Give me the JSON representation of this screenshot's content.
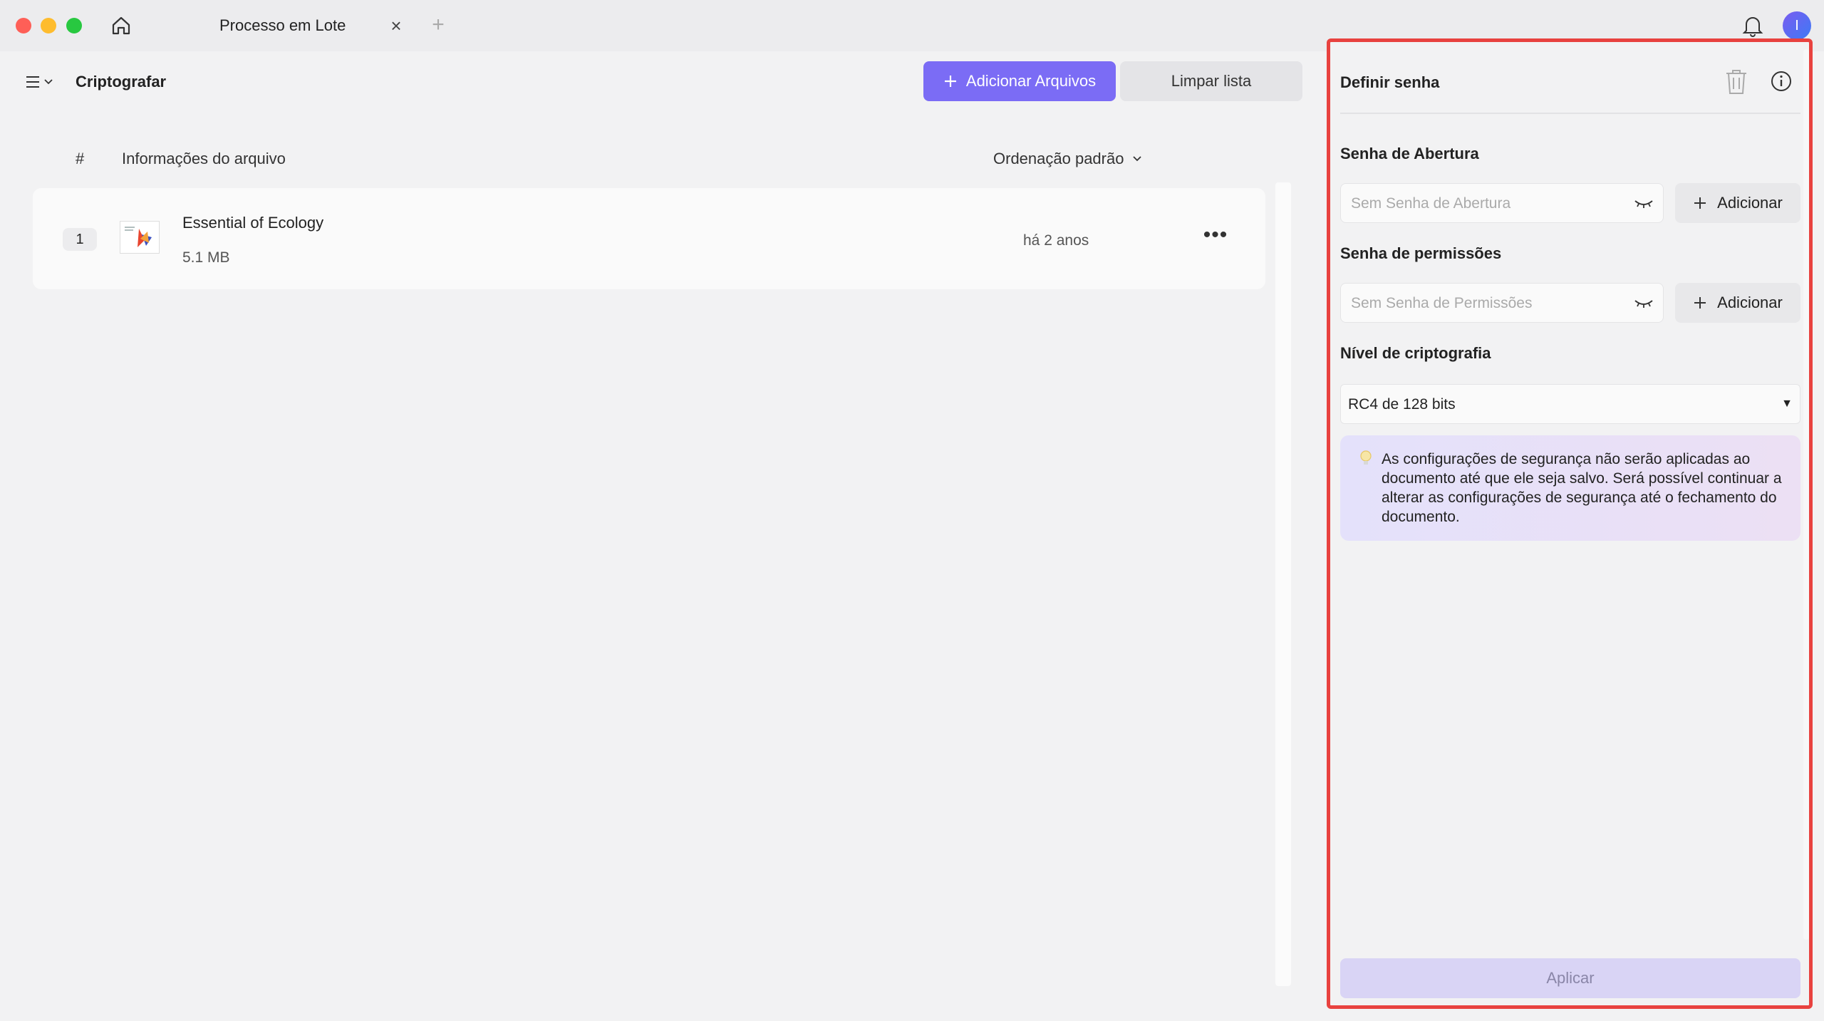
{
  "window": {
    "tab_title": "Processo em Lote",
    "tab_close": "×",
    "tab_add": "+",
    "avatar_initial": "I"
  },
  "toolbar": {
    "page_title": "Criptografar",
    "add_files_label": "Adicionar Arquivos",
    "clear_list_label": "Limpar lista"
  },
  "file_list": {
    "col_number": "#",
    "col_info": "Informações do arquivo",
    "sort_label": "Ordenação padrão",
    "rows": [
      {
        "index": "1",
        "name": "Essential of Ecology",
        "size": "5.1 MB",
        "modified": "há 2 anos",
        "more": "•••"
      }
    ]
  },
  "password_panel": {
    "title": "Definir senha",
    "open_password_label": "Senha de Abertura",
    "open_password_placeholder": "Sem Senha de Abertura",
    "open_add_label": "Adicionar",
    "perm_password_label": "Senha de permissões",
    "perm_password_placeholder": "Sem Senha de Permissões",
    "perm_add_label": "Adicionar",
    "encryption_level_label": "Nível de criptografia",
    "encryption_level_value": "RC4 de 128 bits",
    "notice": "As configurações de segurança não serão aplicadas ao documento até que ele seja salvo. Será possível continuar a alterar as configurações de segurança até o fechamento do documento.",
    "apply_label": "Aplicar"
  },
  "colors": {
    "accent": "#7b6cf5",
    "highlight_border": "#e8423f"
  }
}
